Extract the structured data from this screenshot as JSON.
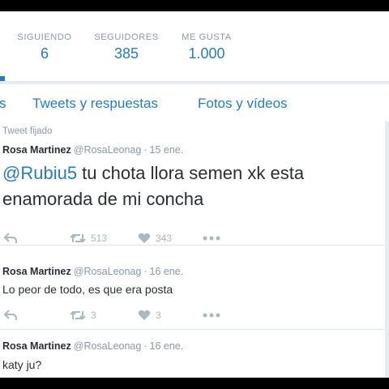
{
  "stats": [
    {
      "label": "SIGUIENDO",
      "value": "6"
    },
    {
      "label": "SEGUIDORES",
      "value": "385"
    },
    {
      "label": "ME GUSTA",
      "value": "1.000"
    }
  ],
  "tabs": [
    {
      "label": "s"
    },
    {
      "label": "Tweets y respuestas"
    },
    {
      "label": "Fotos y vídeos"
    }
  ],
  "tweets": [
    {
      "pinned_label": "Tweet fijado",
      "name": "Rosa Martinez",
      "handle": "@RosaLeonag",
      "separator": "·",
      "date": "15 ene.",
      "mention": "@Rubiu5",
      "text_line1": " tu chota llora semen xk esta",
      "text_line2": "enamorada de mi concha",
      "retweets": "513",
      "likes": "343"
    },
    {
      "name": "Rosa Martinez",
      "handle": "@RosaLeonag",
      "separator": "·",
      "date": "16 ene.",
      "text": "Lo peor de todo, es que era posta",
      "retweets": "3",
      "likes": "3"
    },
    {
      "name": "Rosa Martinez",
      "handle": "@RosaLeonag",
      "separator": "·",
      "date": "16 ene.",
      "text": "katy ju?"
    }
  ],
  "icons": {
    "reply": "reply-icon",
    "retweet": "retweet-icon",
    "like": "heart-icon",
    "more": "more-icon"
  },
  "colors": {
    "accent": "#2b7bb9",
    "muted": "#8899a6",
    "icon": "#aab8c2",
    "text": "#292f33"
  }
}
